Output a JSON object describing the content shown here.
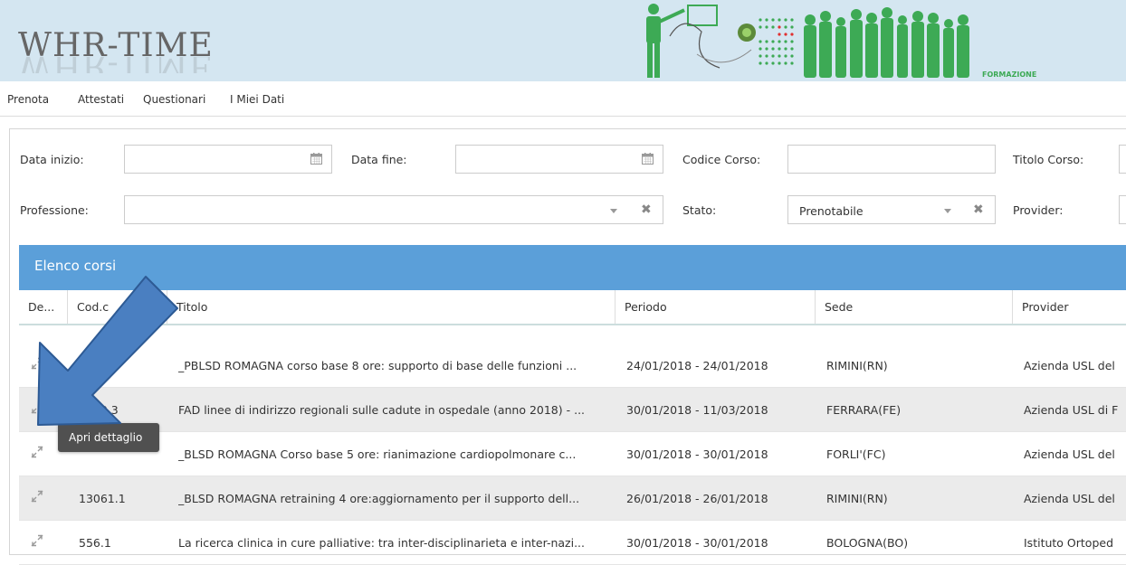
{
  "header": {
    "app_title": "WHR-TIME",
    "banner_label": "FORMAZIONE"
  },
  "menu": {
    "items": [
      "Prenota",
      "Attestati",
      "Questionari",
      "I Miei Dati"
    ]
  },
  "filters": {
    "data_inizio": {
      "label": "Data inizio:",
      "value": ""
    },
    "data_fine": {
      "label": "Data fine:",
      "value": ""
    },
    "codice_corso": {
      "label": "Codice Corso:",
      "value": ""
    },
    "titolo_corso": {
      "label": "Titolo Corso:",
      "value": ""
    },
    "professione": {
      "label": "Professione:",
      "value": ""
    },
    "stato": {
      "label": "Stato:",
      "value": "Prenotabile"
    },
    "provider": {
      "label": "Provider:",
      "value": ""
    }
  },
  "grid": {
    "title": "Elenco corsi",
    "columns": [
      "De...",
      "Cod.c",
      "Titolo",
      "Periodo",
      "Sede",
      "Provider"
    ],
    "rows": [
      {
        "code": "",
        "title": "_PBLSD ROMAGNA corso base 8 ore: supporto di base delle funzioni ...",
        "period": "24/01/2018 - 24/01/2018",
        "site": "RIMINI(RN)",
        "provider": "Azienda USL del"
      },
      {
        "code": "2180.3",
        "title": "FAD linee di indirizzo regionali sulle cadute in ospedale (anno 2018) - ...",
        "period": "30/01/2018 - 11/03/2018",
        "site": "FERRARA(FE)",
        "provider": "Azienda USL di F"
      },
      {
        "code": "",
        "title": "_BLSD ROMAGNA Corso base 5 ore: rianimazione cardiopolmonare c...",
        "period": "30/01/2018 - 30/01/2018",
        "site": "FORLI'(FC)",
        "provider": "Azienda USL del"
      },
      {
        "code": "13061.1",
        "title": "_BLSD ROMAGNA retraining 4 ore:aggiornamento per il supporto dell...",
        "period": "26/01/2018 - 26/01/2018",
        "site": "RIMINI(RN)",
        "provider": "Azienda USL del"
      },
      {
        "code": "556.1",
        "title": "La ricerca clinica in cure palliative: tra inter-disciplinarieta e inter-nazi...",
        "period": "30/01/2018 - 30/01/2018",
        "site": "BOLOGNA(BO)",
        "provider": "Istituto Ortoped"
      }
    ]
  },
  "tooltip": {
    "text": "Apri dettaglio"
  },
  "colors": {
    "header_bg": "#d4e6f1",
    "grid_title_bg": "#5b9fd9",
    "banner_green": "#3daa55",
    "arrow_blue": "#4a7fc1"
  },
  "icons": {
    "calendar": "calendar-icon",
    "expand": "expand-icon",
    "dropdown": "chevron-down-icon",
    "clear": "clear-icon"
  }
}
